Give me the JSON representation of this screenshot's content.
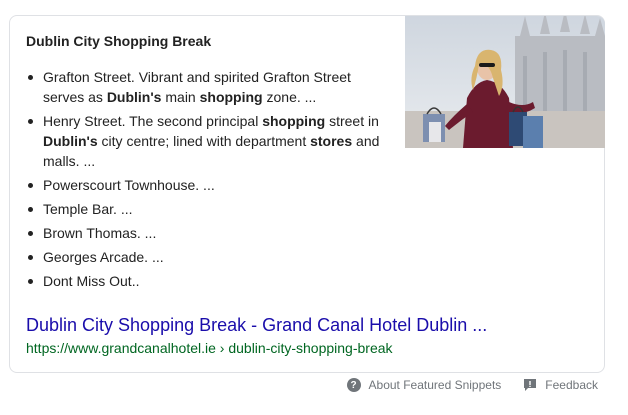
{
  "snippet": {
    "title": "Dublin City Shopping Break",
    "items": [
      {
        "parts": [
          {
            "t": "Grafton Street. Vibrant and spirited Grafton Street serves as ",
            "b": false
          },
          {
            "t": "Dublin's",
            "b": true
          },
          {
            "t": " main ",
            "b": false
          },
          {
            "t": "shopping",
            "b": true
          },
          {
            "t": " zone. ...",
            "b": false
          }
        ]
      },
      {
        "parts": [
          {
            "t": "Henry Street. The second principal ",
            "b": false
          },
          {
            "t": "shopping",
            "b": true
          },
          {
            "t": " street in ",
            "b": false
          },
          {
            "t": "Dublin's",
            "b": true
          },
          {
            "t": " city centre; lined with department ",
            "b": false
          },
          {
            "t": "stores",
            "b": true
          },
          {
            "t": " and malls. ...",
            "b": false
          }
        ]
      },
      {
        "parts": [
          {
            "t": "Powerscourt Townhouse. ...",
            "b": false
          }
        ]
      },
      {
        "parts": [
          {
            "t": "Temple Bar. ...",
            "b": false
          }
        ]
      },
      {
        "parts": [
          {
            "t": "Brown Thomas. ...",
            "b": false
          }
        ]
      },
      {
        "parts": [
          {
            "t": "Georges Arcade. ...",
            "b": false
          }
        ]
      },
      {
        "parts": [
          {
            "t": "Dont Miss Out..",
            "b": false
          }
        ]
      }
    ],
    "image_subject": "woman-with-shopping-bags"
  },
  "result": {
    "link_text": "Dublin City Shopping Break - Grand Canal Hotel Dublin ...",
    "url_text": "https://www.grandcanalhotel.ie › dublin-city-shopping-break"
  },
  "footer": {
    "about_label": "About Featured Snippets",
    "feedback_label": "Feedback",
    "about_icon": "help-circle-icon",
    "feedback_icon": "feedback-flag-icon"
  },
  "colors": {
    "link": "#1a0dab",
    "url": "#006621",
    "text": "#222222",
    "muted": "#70757a",
    "border": "#dfe1e5"
  }
}
